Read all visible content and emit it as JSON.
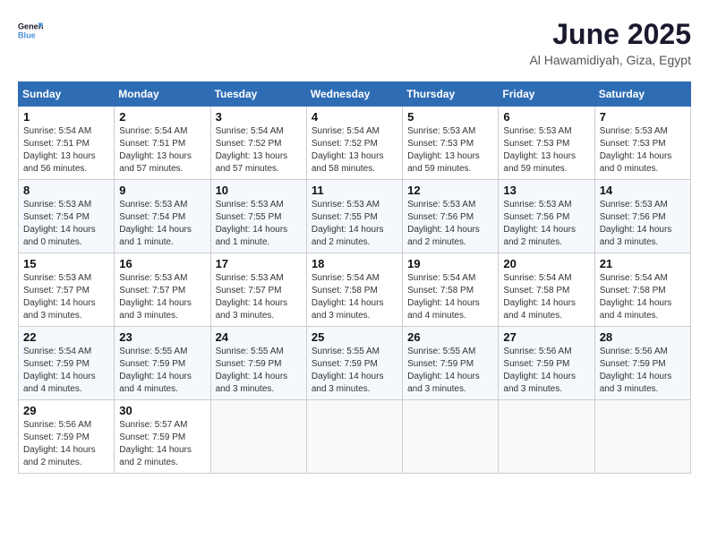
{
  "logo": {
    "line1": "General",
    "line2": "Blue"
  },
  "title": "June 2025",
  "location": "Al Hawamidiyah, Giza, Egypt",
  "weekdays": [
    "Sunday",
    "Monday",
    "Tuesday",
    "Wednesday",
    "Thursday",
    "Friday",
    "Saturday"
  ],
  "weeks": [
    [
      {
        "day": "1",
        "sunrise": "5:54 AM",
        "sunset": "7:51 PM",
        "daylight": "13 hours and 56 minutes."
      },
      {
        "day": "2",
        "sunrise": "5:54 AM",
        "sunset": "7:51 PM",
        "daylight": "13 hours and 57 minutes."
      },
      {
        "day": "3",
        "sunrise": "5:54 AM",
        "sunset": "7:52 PM",
        "daylight": "13 hours and 57 minutes."
      },
      {
        "day": "4",
        "sunrise": "5:54 AM",
        "sunset": "7:52 PM",
        "daylight": "13 hours and 58 minutes."
      },
      {
        "day": "5",
        "sunrise": "5:53 AM",
        "sunset": "7:53 PM",
        "daylight": "13 hours and 59 minutes."
      },
      {
        "day": "6",
        "sunrise": "5:53 AM",
        "sunset": "7:53 PM",
        "daylight": "13 hours and 59 minutes."
      },
      {
        "day": "7",
        "sunrise": "5:53 AM",
        "sunset": "7:53 PM",
        "daylight": "14 hours and 0 minutes."
      }
    ],
    [
      {
        "day": "8",
        "sunrise": "5:53 AM",
        "sunset": "7:54 PM",
        "daylight": "14 hours and 0 minutes."
      },
      {
        "day": "9",
        "sunrise": "5:53 AM",
        "sunset": "7:54 PM",
        "daylight": "14 hours and 1 minute."
      },
      {
        "day": "10",
        "sunrise": "5:53 AM",
        "sunset": "7:55 PM",
        "daylight": "14 hours and 1 minute."
      },
      {
        "day": "11",
        "sunrise": "5:53 AM",
        "sunset": "7:55 PM",
        "daylight": "14 hours and 2 minutes."
      },
      {
        "day": "12",
        "sunrise": "5:53 AM",
        "sunset": "7:56 PM",
        "daylight": "14 hours and 2 minutes."
      },
      {
        "day": "13",
        "sunrise": "5:53 AM",
        "sunset": "7:56 PM",
        "daylight": "14 hours and 2 minutes."
      },
      {
        "day": "14",
        "sunrise": "5:53 AM",
        "sunset": "7:56 PM",
        "daylight": "14 hours and 3 minutes."
      }
    ],
    [
      {
        "day": "15",
        "sunrise": "5:53 AM",
        "sunset": "7:57 PM",
        "daylight": "14 hours and 3 minutes."
      },
      {
        "day": "16",
        "sunrise": "5:53 AM",
        "sunset": "7:57 PM",
        "daylight": "14 hours and 3 minutes."
      },
      {
        "day": "17",
        "sunrise": "5:53 AM",
        "sunset": "7:57 PM",
        "daylight": "14 hours and 3 minutes."
      },
      {
        "day": "18",
        "sunrise": "5:54 AM",
        "sunset": "7:58 PM",
        "daylight": "14 hours and 3 minutes."
      },
      {
        "day": "19",
        "sunrise": "5:54 AM",
        "sunset": "7:58 PM",
        "daylight": "14 hours and 4 minutes."
      },
      {
        "day": "20",
        "sunrise": "5:54 AM",
        "sunset": "7:58 PM",
        "daylight": "14 hours and 4 minutes."
      },
      {
        "day": "21",
        "sunrise": "5:54 AM",
        "sunset": "7:58 PM",
        "daylight": "14 hours and 4 minutes."
      }
    ],
    [
      {
        "day": "22",
        "sunrise": "5:54 AM",
        "sunset": "7:59 PM",
        "daylight": "14 hours and 4 minutes."
      },
      {
        "day": "23",
        "sunrise": "5:55 AM",
        "sunset": "7:59 PM",
        "daylight": "14 hours and 4 minutes."
      },
      {
        "day": "24",
        "sunrise": "5:55 AM",
        "sunset": "7:59 PM",
        "daylight": "14 hours and 3 minutes."
      },
      {
        "day": "25",
        "sunrise": "5:55 AM",
        "sunset": "7:59 PM",
        "daylight": "14 hours and 3 minutes."
      },
      {
        "day": "26",
        "sunrise": "5:55 AM",
        "sunset": "7:59 PM",
        "daylight": "14 hours and 3 minutes."
      },
      {
        "day": "27",
        "sunrise": "5:56 AM",
        "sunset": "7:59 PM",
        "daylight": "14 hours and 3 minutes."
      },
      {
        "day": "28",
        "sunrise": "5:56 AM",
        "sunset": "7:59 PM",
        "daylight": "14 hours and 3 minutes."
      }
    ],
    [
      {
        "day": "29",
        "sunrise": "5:56 AM",
        "sunset": "7:59 PM",
        "daylight": "14 hours and 2 minutes."
      },
      {
        "day": "30",
        "sunrise": "5:57 AM",
        "sunset": "7:59 PM",
        "daylight": "14 hours and 2 minutes."
      },
      null,
      null,
      null,
      null,
      null
    ]
  ]
}
